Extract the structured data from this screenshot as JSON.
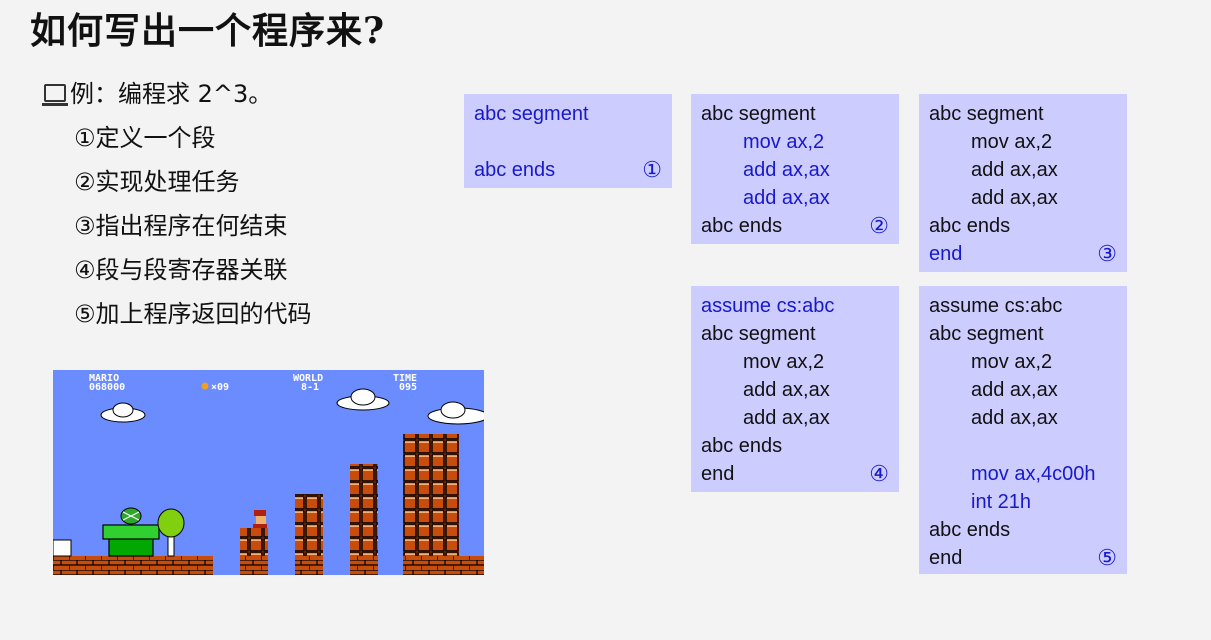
{
  "title": "如何写出一个程序来?",
  "intro": "例：编程求 2^3。",
  "steps": [
    "①定义一个段",
    "②实现处理任务",
    "③指出程序在何结束",
    "④段与段寄存器关联",
    "⑤加上程序返回的代码"
  ],
  "game": {
    "mario_label": "MARIO",
    "score": "068000",
    "coins": "×09",
    "world_label": "WORLD",
    "world": "8-1",
    "time_label": "TIME",
    "time": "095"
  },
  "boxes": [
    {
      "number": "①",
      "lines": [
        {
          "text": "abc segment",
          "indent": false,
          "blue": true
        },
        {
          "text": "",
          "indent": false,
          "blue": true
        },
        {
          "text": "abc ends",
          "indent": false,
          "blue": true
        }
      ]
    },
    {
      "number": "②",
      "lines": [
        {
          "text": "abc segment",
          "indent": false,
          "blue": false
        },
        {
          "text": "mov ax,2",
          "indent": true,
          "blue": true
        },
        {
          "text": "add ax,ax",
          "indent": true,
          "blue": true
        },
        {
          "text": "add ax,ax",
          "indent": true,
          "blue": true
        },
        {
          "text": "abc ends",
          "indent": false,
          "blue": false
        }
      ]
    },
    {
      "number": "③",
      "lines": [
        {
          "text": "abc segment",
          "indent": false,
          "blue": false
        },
        {
          "text": "mov ax,2",
          "indent": true,
          "blue": false
        },
        {
          "text": "add ax,ax",
          "indent": true,
          "blue": false
        },
        {
          "text": "add ax,ax",
          "indent": true,
          "blue": false
        },
        {
          "text": "abc ends",
          "indent": false,
          "blue": false
        },
        {
          "text": "end",
          "indent": false,
          "blue": true
        }
      ]
    },
    {
      "number": "④",
      "lines": [
        {
          "text": "assume cs:abc",
          "indent": false,
          "blue": true
        },
        {
          "text": "abc segment",
          "indent": false,
          "blue": false
        },
        {
          "text": "mov ax,2",
          "indent": true,
          "blue": false
        },
        {
          "text": "add ax,ax",
          "indent": true,
          "blue": false
        },
        {
          "text": "add ax,ax",
          "indent": true,
          "blue": false
        },
        {
          "text": "abc ends",
          "indent": false,
          "blue": false
        },
        {
          "text": "end",
          "indent": false,
          "blue": false
        }
      ]
    },
    {
      "number": "⑤",
      "lines": [
        {
          "text": "assume cs:abc",
          "indent": false,
          "blue": false
        },
        {
          "text": "abc segment",
          "indent": false,
          "blue": false
        },
        {
          "text": "mov ax,2",
          "indent": true,
          "blue": false
        },
        {
          "text": "add ax,ax",
          "indent": true,
          "blue": false
        },
        {
          "text": "add ax,ax",
          "indent": true,
          "blue": false
        },
        {
          "text": "",
          "indent": true,
          "blue": false
        },
        {
          "text": "mov ax,4c00h",
          "indent": true,
          "blue": true
        },
        {
          "text": "int 21h",
          "indent": true,
          "blue": true
        },
        {
          "text": "abc ends",
          "indent": false,
          "blue": false
        },
        {
          "text": "end",
          "indent": false,
          "blue": false
        }
      ]
    }
  ],
  "colors": {
    "box_bg": "#ccccff",
    "code_blue": "#1818cc",
    "sky": "#6b8cff"
  }
}
